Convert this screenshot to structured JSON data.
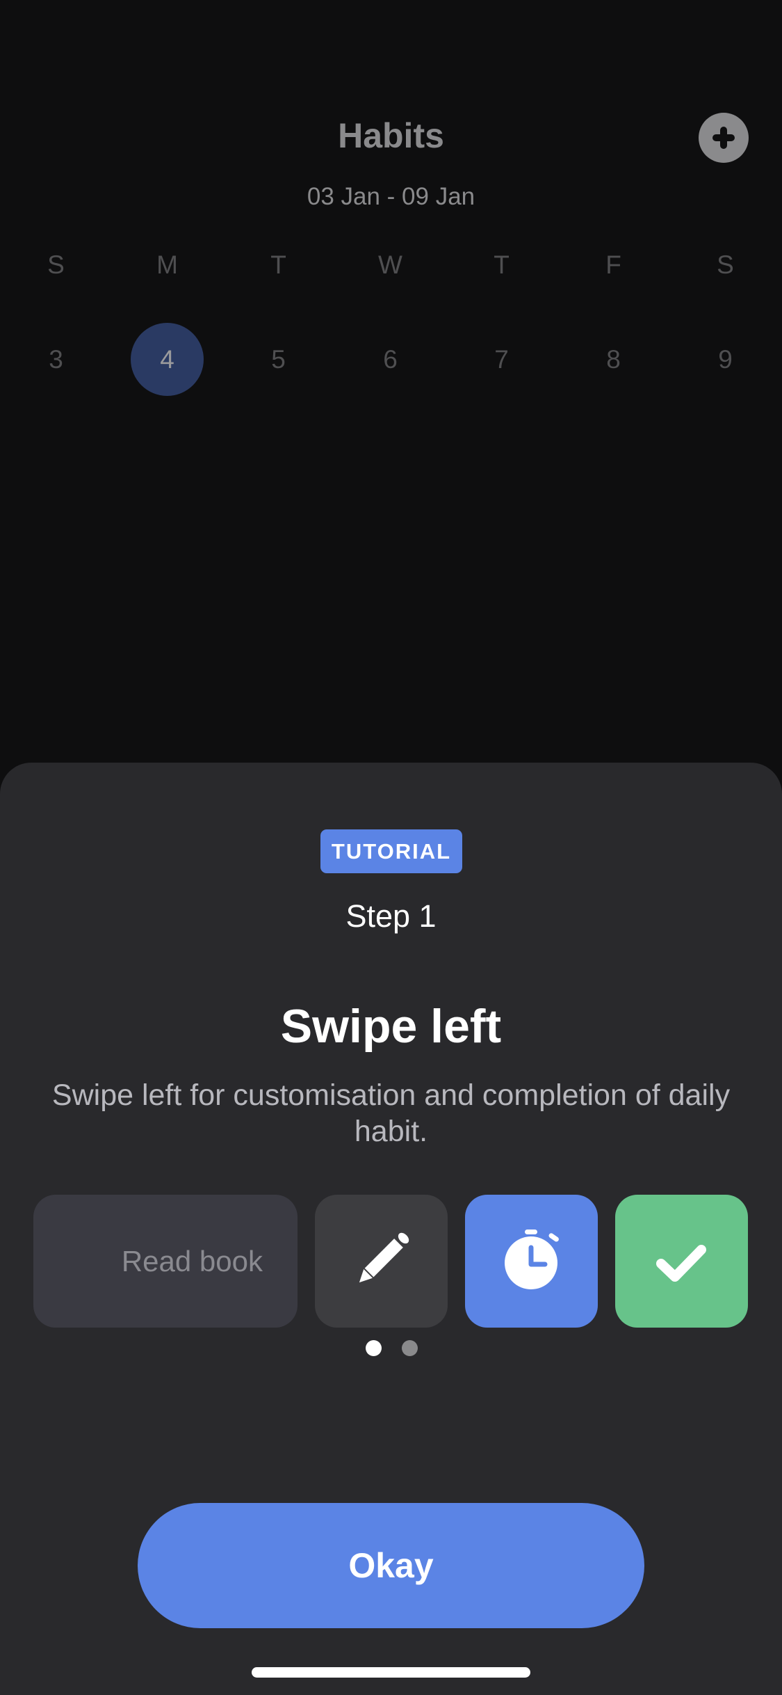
{
  "header": {
    "title": "Habits",
    "date_range": "03 Jan - 09 Jan",
    "add_icon": "plus-circle-icon"
  },
  "week": {
    "days": [
      {
        "dow": "S",
        "date": "3",
        "selected": false
      },
      {
        "dow": "M",
        "date": "4",
        "selected": true
      },
      {
        "dow": "T",
        "date": "5",
        "selected": false
      },
      {
        "dow": "W",
        "date": "6",
        "selected": false
      },
      {
        "dow": "T",
        "date": "7",
        "selected": false
      },
      {
        "dow": "F",
        "date": "8",
        "selected": false
      },
      {
        "dow": "S",
        "date": "9",
        "selected": false
      }
    ]
  },
  "tutorial": {
    "badge": "TUTORIAL",
    "step": "Step 1",
    "title": "Swipe left",
    "description": "Swipe left for customisation and completion of daily habit.",
    "demo_row": {
      "habit_name": "Read book",
      "actions": [
        {
          "name": "edit",
          "icon": "pencil-icon",
          "color": "#3d3d40"
        },
        {
          "name": "timer",
          "icon": "stopwatch-icon",
          "color": "#5b84e5"
        },
        {
          "name": "complete",
          "icon": "checkmark-icon",
          "color": "#67c38a"
        }
      ]
    },
    "pagination": {
      "current": 1,
      "total": 2
    },
    "confirm_button": "Okay"
  },
  "colors": {
    "accent": "#5b84e5",
    "success": "#67c38a",
    "background": "#0e0e0f",
    "sheet": "#29292c"
  }
}
